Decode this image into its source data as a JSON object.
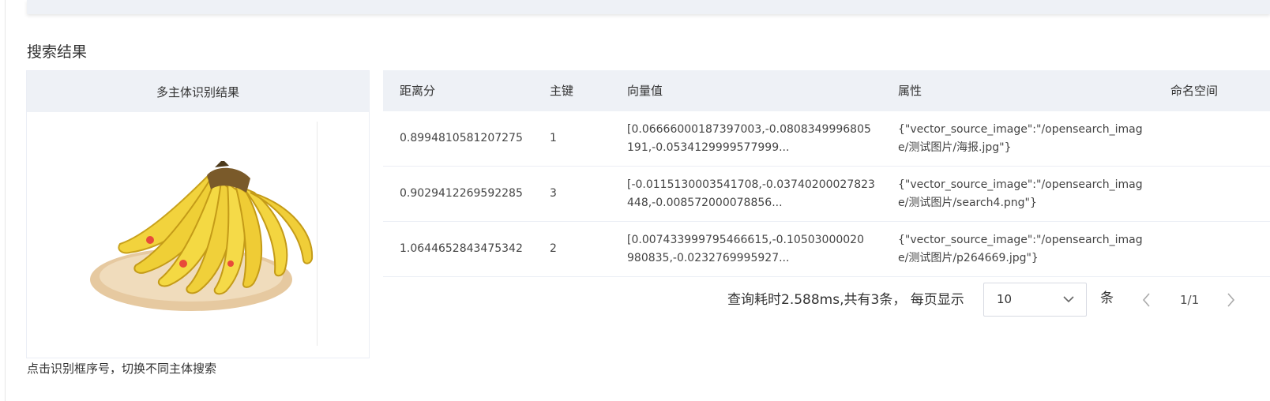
{
  "section_title": "搜索结果",
  "detection": {
    "header": "多主体识别结果",
    "hint": "点击识别框序号，切换不同主体搜索"
  },
  "table": {
    "columns": [
      "距离分",
      "主键",
      "向量值",
      "属性",
      "命名空间"
    ],
    "rows": [
      {
        "score": "0.8994810581207275",
        "key": "1",
        "vector": [
          "[0.06666000187397003,-0.0808349996805",
          "191,-0.0534129999577999..."
        ],
        "attr": [
          "{\"vector_source_image\":\"/opensearch_imag",
          "e/测试图片/海报.jpg\"}"
        ],
        "namespace": ""
      },
      {
        "score": "0.9029412269592285",
        "key": "3",
        "vector": [
          "[-0.0115130003541708,-0.03740200027823",
          "448,-0.008572000078856..."
        ],
        "attr": [
          "{\"vector_source_image\":\"/opensearch_imag",
          "e/测试图片/search4.png\"}"
        ],
        "namespace": ""
      },
      {
        "score": "1.0644652843475342",
        "key": "2",
        "vector": [
          "[0.007433999795466615,-0.10503000020",
          "980835,-0.0232769995927..."
        ],
        "attr": [
          "{\"vector_source_image\":\"/opensearch_imag",
          "e/测试图片/p264669.jpg\"}"
        ],
        "namespace": ""
      }
    ]
  },
  "pagination": {
    "summary": "查询耗时2.588ms,共有3条，  每页显示",
    "page_size": "10",
    "unit": "条",
    "page": "1/1"
  },
  "icons": {
    "select_chevron": "chevron-down-icon",
    "prev": "chevron-left-icon",
    "next": "chevron-right-icon"
  }
}
